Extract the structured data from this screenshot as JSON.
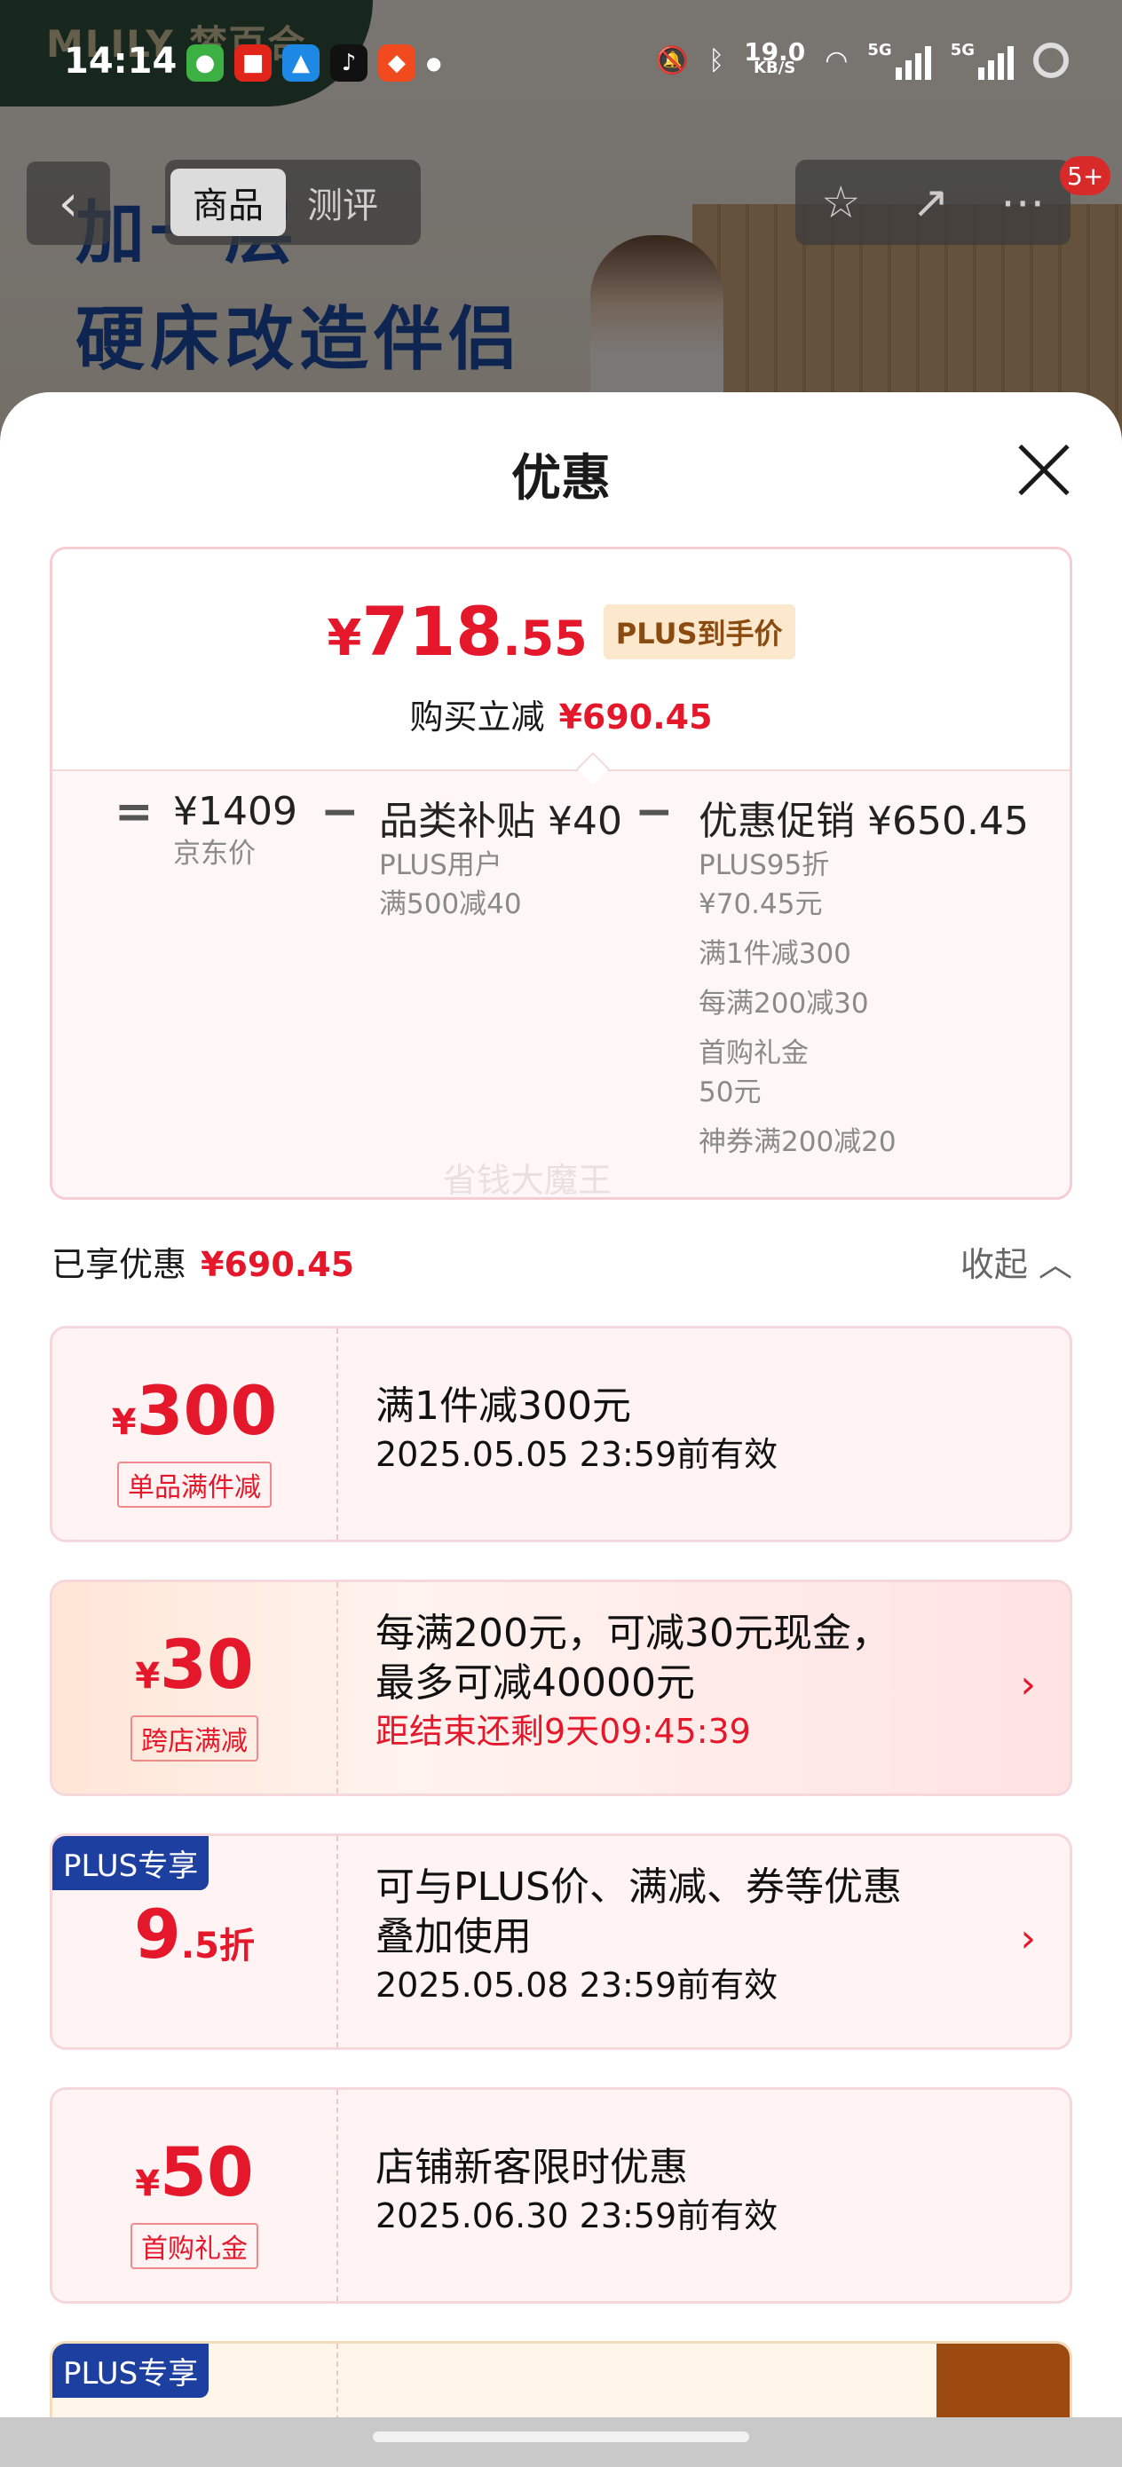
{
  "status_bar": {
    "time": "14:14",
    "net_speed": "19.0",
    "net_unit": "KB/S",
    "signal1": "5G",
    "signal2": "5G",
    "app_icons": [
      "wechat-icon",
      "jd-icon",
      "maps-icon",
      "douyin-icon",
      "man-icon"
    ]
  },
  "background": {
    "logo": "MLILY 梦百合",
    "headline1": "加一层",
    "headline2": "硬床改造伴侣"
  },
  "nav": {
    "tabs": [
      "商品",
      "测评"
    ],
    "message_badge": "5+"
  },
  "sheet": {
    "title": "优惠",
    "summary": {
      "price_currency": "¥",
      "price_int": "718",
      "price_cents": ".55",
      "plus_tag": "PLUS到手价",
      "reduce_label": "购买立减",
      "reduce_value": "¥690.45",
      "breakdown": {
        "eq": "=",
        "minus": "−",
        "jd_price": "¥1409",
        "jd_label": "京东价",
        "subsidy_title": "品类补贴 ¥40",
        "subsidy_lines": [
          "PLUS用户",
          "满500减40"
        ],
        "promo_title": "优惠促销 ¥650.45",
        "promo_lines": [
          "PLUS95折",
          "¥70.45元",
          "满1件减300",
          "每满200减30",
          "首购礼金",
          "50元",
          "神券满200减20"
        ]
      },
      "watermark": "省钱大魔王"
    },
    "enjoyed_label": "已享优惠",
    "enjoyed_value": "¥690.45",
    "collapse_label": "收起",
    "coupons": [
      {
        "currency": "¥",
        "amount": "300",
        "suffix": "",
        "label": "单品满件减",
        "line1": "满1件减300元",
        "line2": "2025.05.05 23:59前有效"
      },
      {
        "currency": "¥",
        "amount": "30",
        "suffix": "",
        "label": "跨店满减",
        "line1": "每满200元，可减30元现金，",
        "line2": "最多可减40000元",
        "line3": "距结束还剩9天09:45:39"
      },
      {
        "currency": "",
        "amount": "9",
        "suffix": ".5折",
        "label": "",
        "corner": "PLUS专享",
        "line1": "可与PLUS价、满减、券等优惠",
        "line2": "叠加使用",
        "line3": "2025.05.08 23:59前有效"
      },
      {
        "currency": "¥",
        "amount": "50",
        "suffix": "",
        "label": "首购礼金",
        "line1": "店铺新客限时优惠",
        "line2": "2025.06.30 23:59前有效"
      },
      {
        "corner": "PLUS专享"
      }
    ],
    "chevron": "›"
  },
  "colors": {
    "accent_red": "#e5172b",
    "plus_blue": "#1d3fa0",
    "gold": "#9c4a10"
  }
}
